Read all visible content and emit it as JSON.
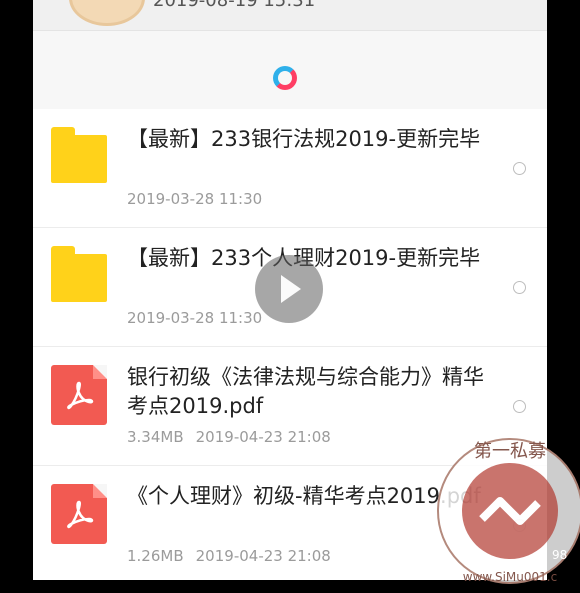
{
  "header": {
    "top_time": "2019-08-19 15:31"
  },
  "files": [
    {
      "type": "folder",
      "title": "【最新】233银行法规2019-更新完毕",
      "meta": "2019-03-28 11:30"
    },
    {
      "type": "folder",
      "title": "【最新】233个人理财2019-更新完毕",
      "meta": "2019-03-28 11:30"
    },
    {
      "type": "pdf",
      "title": "银行初级《法律法规与综合能力》精华考点2019.pdf",
      "size": "3.34MB",
      "date": "2019-04-23 21:08"
    },
    {
      "type": "pdf",
      "title": "《个人理财》初级-精华考点2019.pdf",
      "size": "1.26MB",
      "date": "2019-04-23 21:08"
    }
  ],
  "watermark": {
    "top_text": "第一私募",
    "bottom_text": "www.SiMu001.c",
    "side_text": "98"
  },
  "colors": {
    "folder": "#ffd21a",
    "pdf": "#f25a52",
    "spinner_blue": "#2fb0ea",
    "spinner_red": "#ff3e64"
  }
}
